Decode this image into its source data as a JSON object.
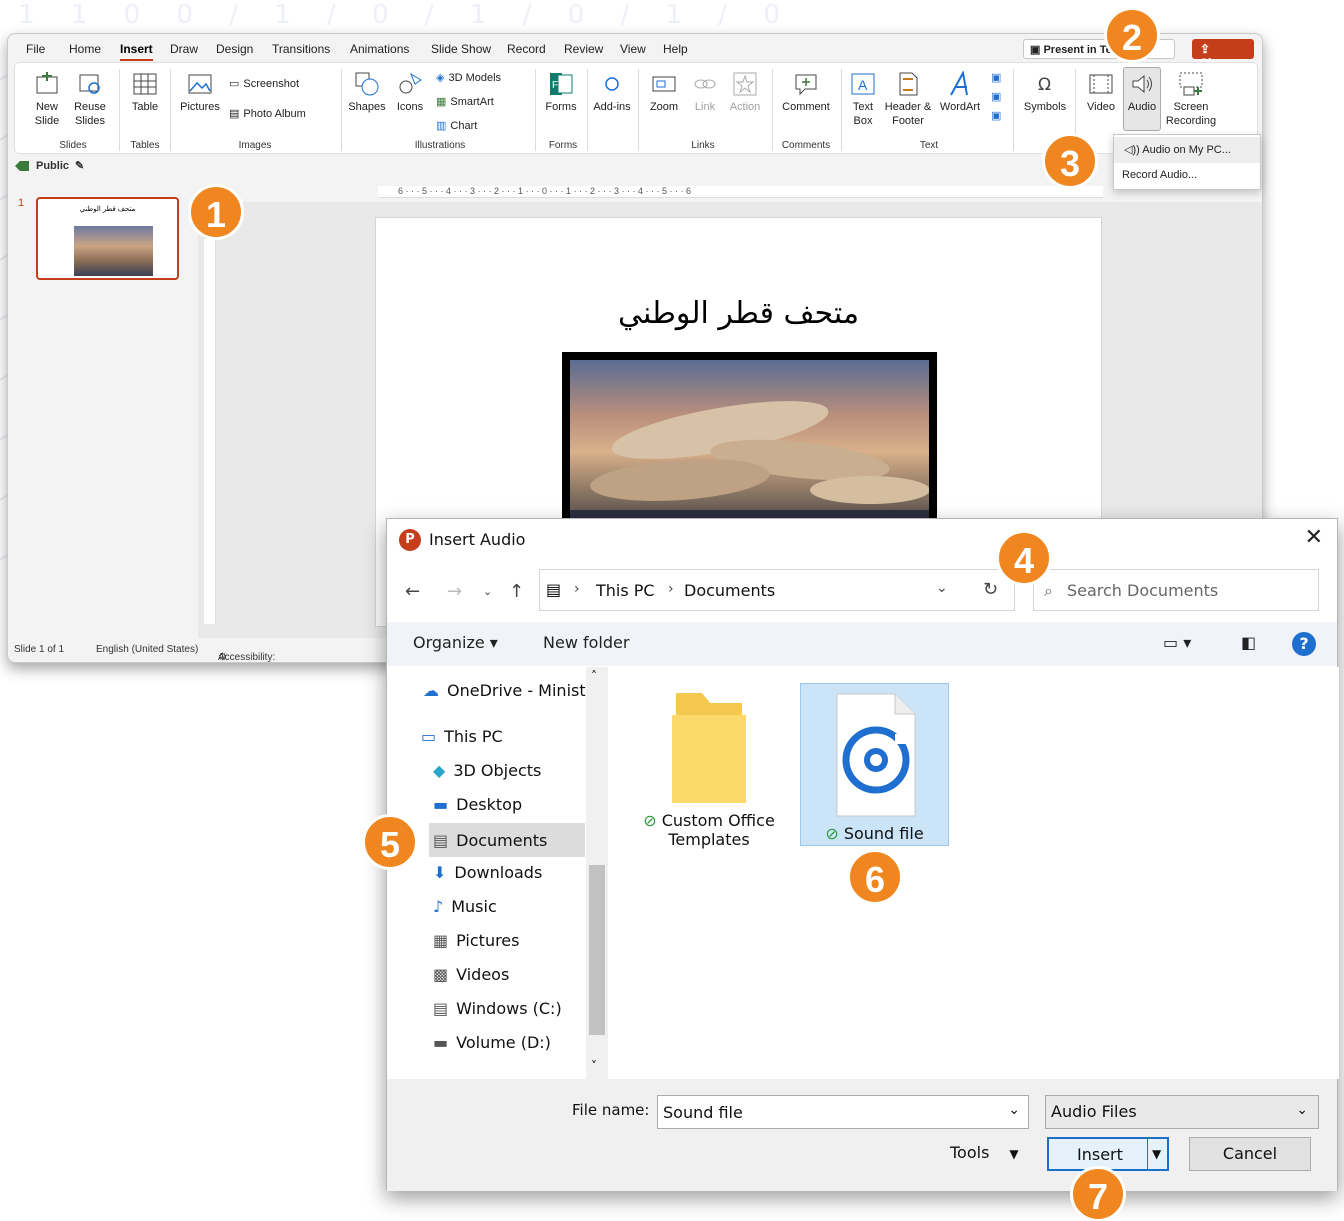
{
  "background": {
    "digits": "1 1 0 0 / 1 / 0 / 1 / 0 / 1 / 0"
  },
  "ppt": {
    "menu_tabs": [
      "File",
      "Home",
      "Insert",
      "Draw",
      "Design",
      "Transitions",
      "Animations",
      "Slide Show",
      "Record",
      "Review",
      "View",
      "Help"
    ],
    "active_tab": "Insert",
    "present_label": "Present in Teams",
    "share_label": "Share",
    "ribbon": {
      "new_slide": "New Slide",
      "reuse_slides": "Reuse Slides",
      "table": "Table",
      "pictures": "Pictures",
      "screenshot": "Screenshot",
      "photo_album": "Photo Album",
      "shapes": "Shapes",
      "icons": "Icons",
      "models_3d": "3D Models",
      "smartart": "SmartArt",
      "chart": "Chart",
      "forms": "Forms",
      "addins": "Add-ins",
      "zoom": "Zoom",
      "link": "Link",
      "action": "Action",
      "comment": "Comment",
      "text_box": "Text Box",
      "header_footer": "Header & Footer",
      "wordart": "WordArt",
      "symbols": "Symbols",
      "video": "Video",
      "audio": "Audio",
      "screen_recording": "Screen Recording",
      "groups": {
        "slides": "Slides",
        "tables": "Tables",
        "images": "Images",
        "illustrations": "Illustrations",
        "forms": "Forms",
        "links": "Links",
        "comments": "Comments",
        "text": "Text"
      }
    },
    "sensitivity_label": "Public",
    "slide_number": "1",
    "slide_title": "متحف قطر الوطني",
    "ruler_h": "6 · · · 5 · · · 4 · · · 3 · · · 2 · · · 1 · · · 0 · · · 1 · · · 2 · · · 3 · · · 4 · · · 5 · · · 6",
    "status": {
      "slide_count": "Slide 1 of 1",
      "language": "English (United States)",
      "accessibility": "Accessibility: Investigate"
    },
    "audio_menu": {
      "item1": "Audio on My PC...",
      "item2": "Record Audio..."
    }
  },
  "dialog": {
    "title": "Insert Audio",
    "breadcrumb": [
      "This PC",
      "Documents"
    ],
    "search_placeholder": "Search Documents",
    "organize": "Organize ▾",
    "new_folder": "New folder",
    "tree": [
      "OneDrive - Minist",
      "This PC",
      "3D Objects",
      "Desktop",
      "Documents",
      "Downloads",
      "Music",
      "Pictures",
      "Videos",
      "Windows (C:)",
      "Volume (D:)"
    ],
    "files": [
      {
        "name_line1": "Custom Office",
        "name_line2": "Templates",
        "icon": "folder-icon"
      },
      {
        "name_line1": "Sound file",
        "icon": "audio-file-icon"
      }
    ],
    "file_name_label": "File name:",
    "file_name_value": "Sound file",
    "file_type": "Audio Files",
    "tools": "Tools",
    "insert": "Insert",
    "cancel": "Cancel"
  },
  "steps": [
    "1",
    "2",
    "3",
    "4",
    "5",
    "6",
    "7"
  ],
  "colors": {
    "accent": "#c43e1c",
    "step_badge": "#f0861f",
    "selection": "#cce4f7"
  }
}
